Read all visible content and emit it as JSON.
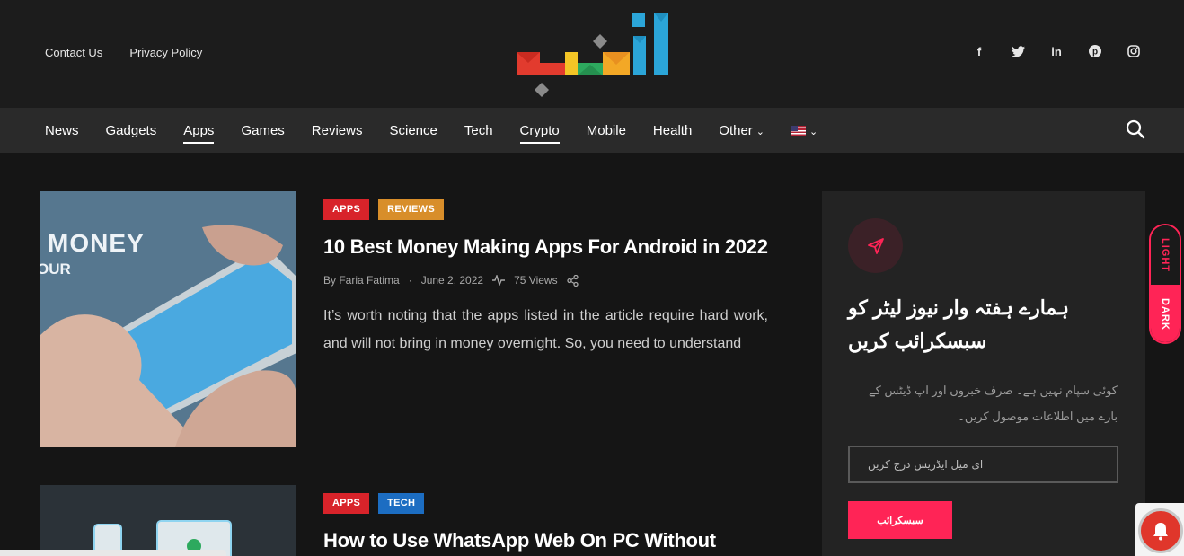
{
  "top_links": [
    "Contact Us",
    "Privacy Policy"
  ],
  "social_icons": [
    "facebook-icon",
    "twitter-icon",
    "linkedin-icon",
    "pinterest-icon",
    "instagram-icon"
  ],
  "nav": {
    "items": [
      "News",
      "Gadgets",
      "Apps",
      "Games",
      "Reviews",
      "Science",
      "Tech",
      "Crypto",
      "Mobile",
      "Health",
      "Other"
    ],
    "active": [
      "Apps",
      "Crypto"
    ]
  },
  "posts": [
    {
      "tags": [
        {
          "label": "APPS",
          "color": "#d8232a"
        },
        {
          "label": "REVIEWS",
          "color": "#d88e2a"
        }
      ],
      "title": "10 Best Money Making Apps For Android in 2022",
      "author": "By Faria Fatima",
      "date": "June 2, 2022",
      "views": "75 Views",
      "excerpt": "It’s worth noting that the apps listed in the article require hard work, and will not bring in money overnight. So, you need to understand",
      "thumb_text1": "MONEY",
      "thumb_text2": "OUR"
    },
    {
      "tags": [
        {
          "label": "APPS",
          "color": "#d8232a"
        },
        {
          "label": "TECH",
          "color": "#1c6dc2"
        }
      ],
      "title": "How to Use WhatsApp Web On PC Without"
    }
  ],
  "newsletter": {
    "title": "ہمارے ہفتہ وار نیوز لیٹر کو سبسکرائب کریں",
    "text": "کوئی سپام نہیں ہے۔ صرف خبروں اور اپ ڈیٹس کے بارے میں اطلاعات موصول کریں۔",
    "placeholder": "ای میل ایڈریس درج کریں",
    "button": "سبسکرائب"
  },
  "theme_toggle": {
    "light": "LIGHT",
    "dark": "DARK"
  },
  "colors": {
    "accent": "#ff2456",
    "bg": "#151515"
  }
}
